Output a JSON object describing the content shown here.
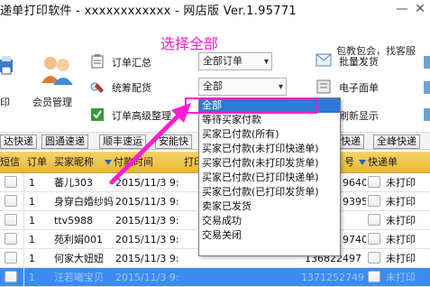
{
  "window": {
    "title": "递单打印软件 - xxxxxxxxxxxx - 网店版 Ver.1.95771",
    "minimize_glyph": "—",
    "close_glyph": "✕"
  },
  "header": {
    "top_right_link": "包教包会，找客服"
  },
  "toolbar": {
    "print_label": "印",
    "member_label": "会员管理",
    "order_summary_label": "订单汇总",
    "unified_delivery_label": "统筹配货",
    "order_advanced_label": "订单高级整理",
    "batch_ship_label": "批量发货",
    "e_waybill_label": "电子面单",
    "refresh_label": "刷新显示",
    "order_type_combo": "全部订单",
    "status_combo": "全部"
  },
  "annotation": {
    "text": "选择全部",
    "color": "#ff1dd0"
  },
  "status_dropdown": {
    "options": [
      "全部",
      "等待买家付款",
      "买家已付款(所有)",
      "买家已付款(未打印快递单)",
      "买家已付款(未打印发货单)",
      "买家已付款(已打印快递单)",
      "买家已付款(已打印发货单)",
      "卖家已发货",
      "交易成功",
      "交易关闭"
    ],
    "selected_index": 0
  },
  "express_bar": {
    "buttons": [
      "达快递",
      "圆通速递",
      "顺丰速运",
      "安能快",
      "圆通快递",
      "全峰快递"
    ]
  },
  "table": {
    "headers": {
      "sms": "短信",
      "order": "订单",
      "buyer": "买家昵称",
      "pay_time": "付款时间",
      "print": "打印",
      "number": "号",
      "express": "快递单"
    },
    "rows": [
      {
        "sms": "",
        "order": "1",
        "buyer": "蕃儿303",
        "pay_time": "2015/11/3 9:",
        "number": "9640",
        "express": "未打印"
      },
      {
        "sms": "",
        "order": "1",
        "buyer": "身穿白婚纱妈",
        "pay_time": "2015/11/3 9:",
        "number": "9395",
        "express": "未打印"
      },
      {
        "sms": "",
        "order": "1",
        "buyer": "ttv5988",
        "pay_time": "2015/11/3 9:",
        "number": "",
        "express": "未打印"
      },
      {
        "sms": "",
        "order": "1",
        "buyer": "苑利娟001",
        "pay_time": "2015/11/3 9:",
        "number": "9740",
        "express": "未打印"
      },
      {
        "sms": "",
        "order": "1",
        "buyer": "何家大妞妞",
        "pay_time": "2015/11/3 9:",
        "number": "136822497",
        "express": "未打印"
      },
      {
        "sms": "",
        "order": "1",
        "buyer": "汪若曦宝贝",
        "pay_time": "2015/11/3 9:",
        "number": "1371252749",
        "express": "未打印"
      }
    ]
  }
}
